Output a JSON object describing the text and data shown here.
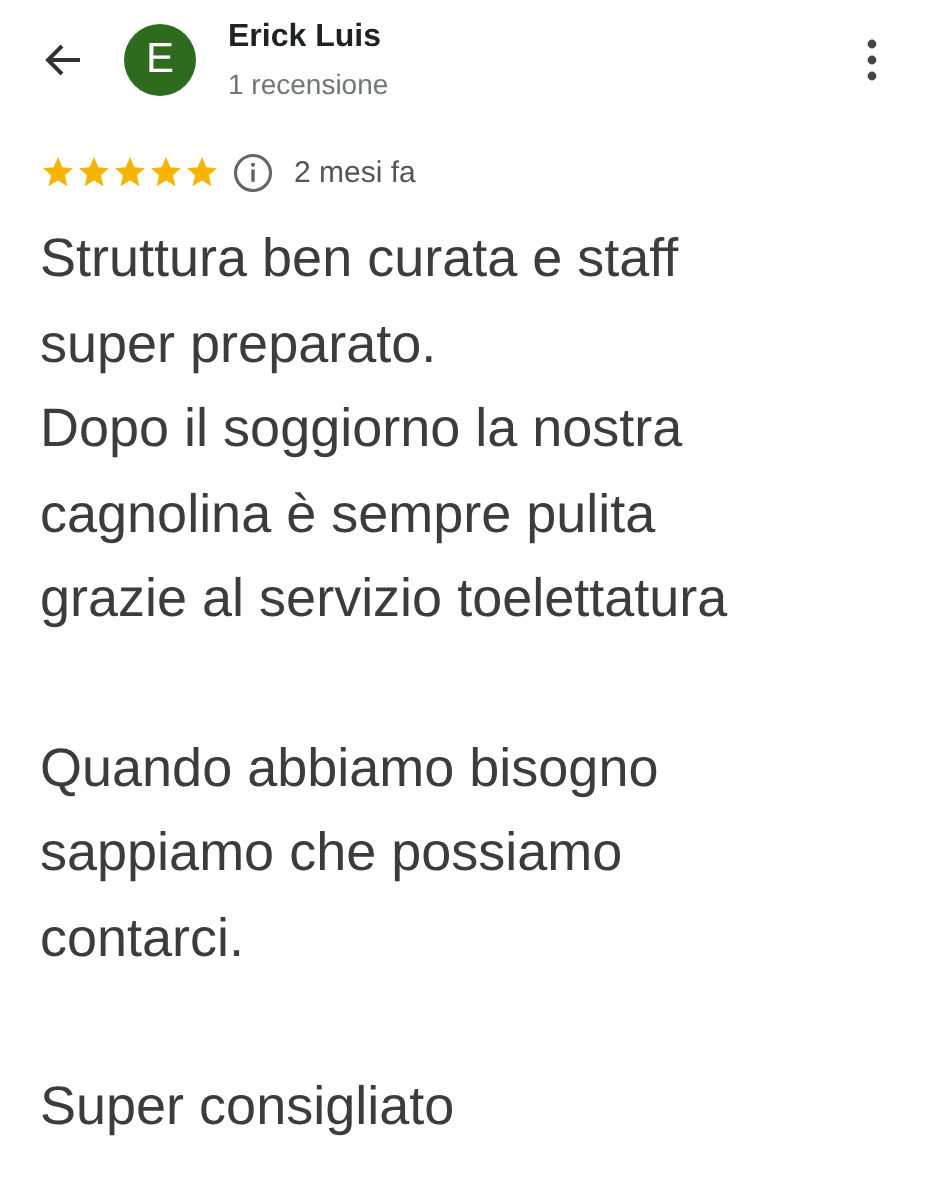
{
  "header": {
    "avatar": {
      "letter": "E",
      "color": "#2e6b1f"
    },
    "name": "Erick Luis",
    "subtitle": "1 recensione"
  },
  "review": {
    "stars": 5,
    "date": "2 mesi fa",
    "paragraphs": [
      "Struttura ben curata e staff\nsuper preparato.\nDopo il soggiorno la nostra\ncagnolina è sempre pulita\ngrazie al servizio toelettatura",
      "Quando abbiamo bisogno\nsappiamo che possiamo\ncontarci.",
      "Super consigliato"
    ]
  }
}
